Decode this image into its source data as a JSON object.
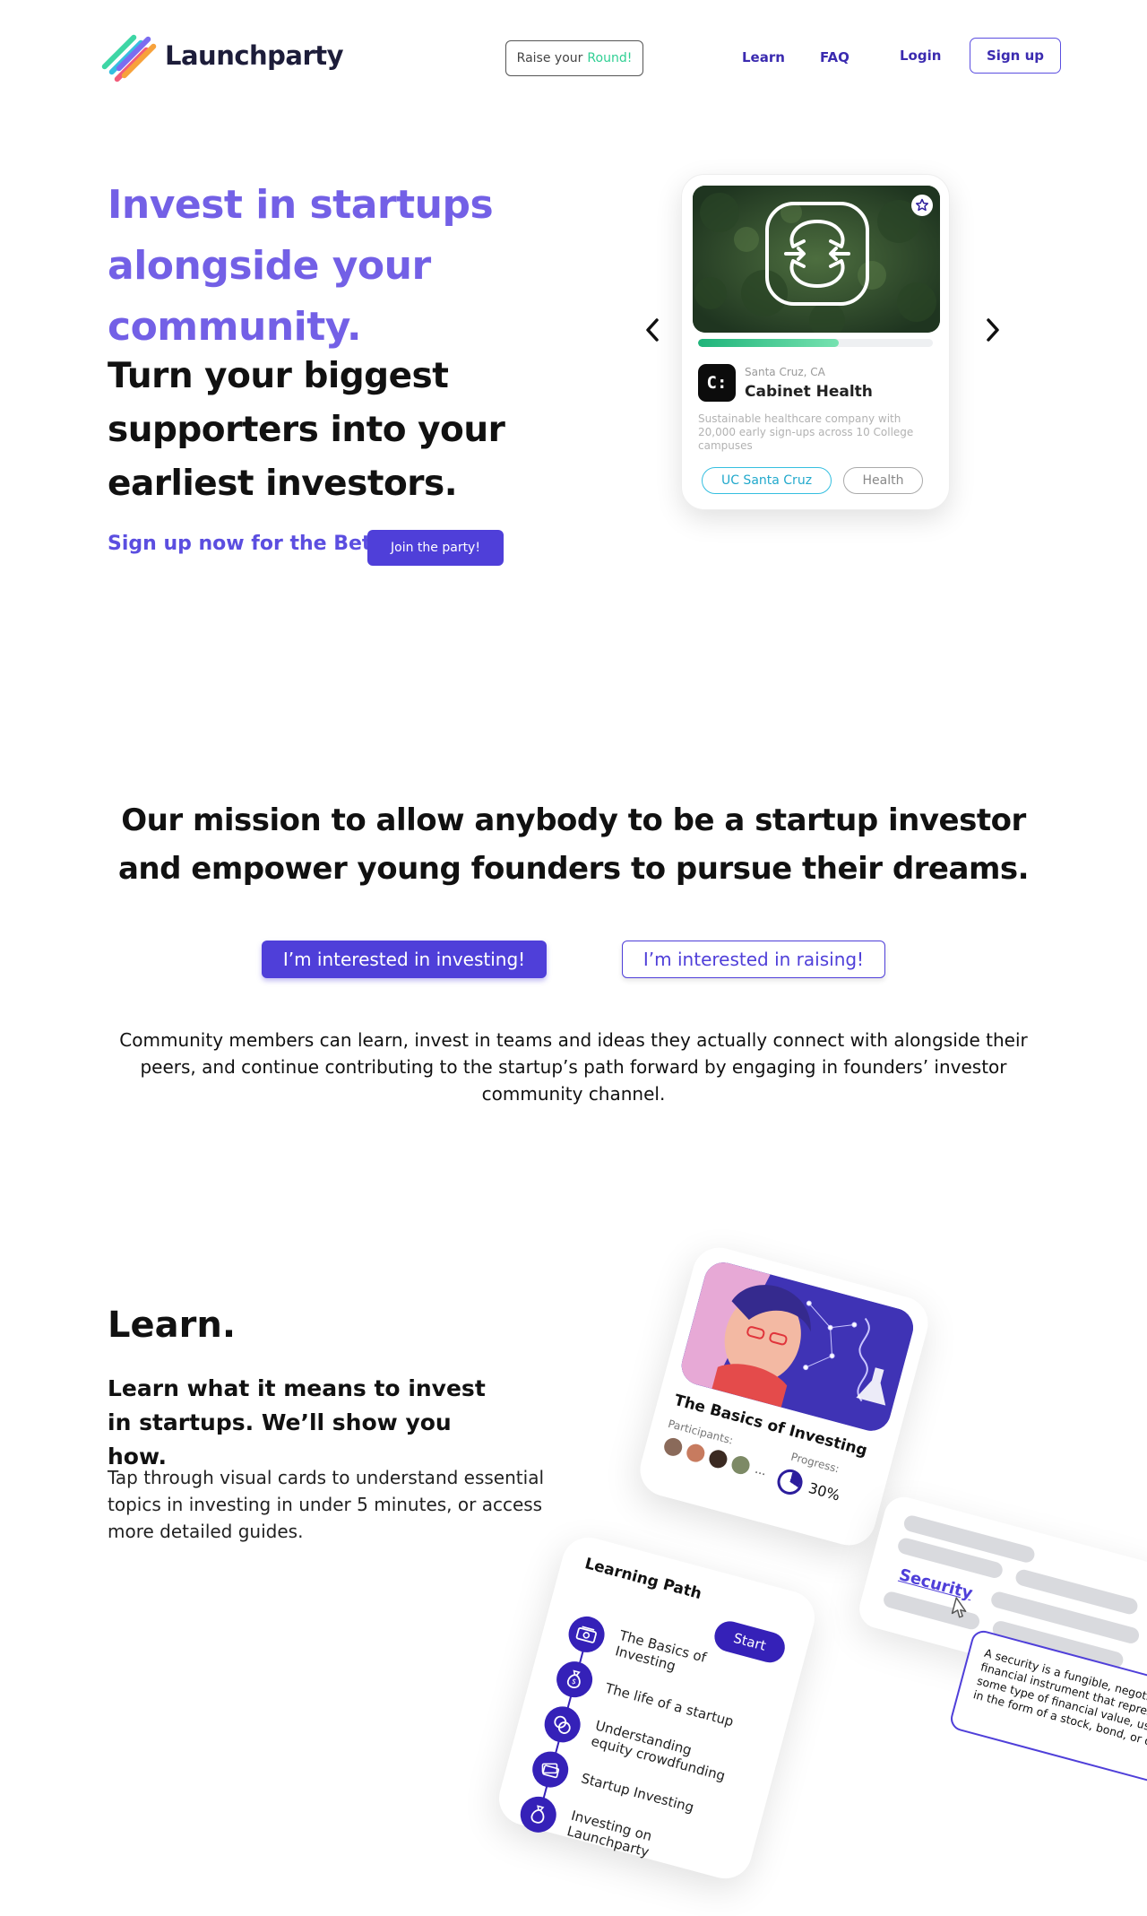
{
  "header": {
    "brand": "Launchparty",
    "raise_prefix": "Raise your",
    "raise_accent": "Round!",
    "nav": {
      "learn": "Learn",
      "faq": "FAQ",
      "login": "Login",
      "signup": "Sign up"
    },
    "logo_colors": [
      "#3ed6a5",
      "#35bfe0",
      "#7c6cf0",
      "#f25c7a",
      "#f7a23b"
    ]
  },
  "hero": {
    "title": "Invest in startups alongside your community.",
    "subtitle": "Turn your biggest supporters into your earliest investors.",
    "beta_text": "Sign up now for the Beta",
    "join_button": "Join the party!"
  },
  "company_card": {
    "location": "Santa Cruz, CA",
    "name": "Cabinet Health",
    "logo_text": "C:",
    "description": "Sustainable healthcare company with 20,000 early sign-ups across 10 College campuses",
    "funding_progress": 0.6,
    "tags": [
      "UC Santa Cruz",
      "Health"
    ],
    "icons": {
      "prev": "chevron-left-icon",
      "next": "chevron-right-icon",
      "favorite": "star-icon"
    }
  },
  "mission": {
    "text": "Our mission to allow anybody to be a startup investor and empower young founders to pursue their dreams.",
    "invest_button": "I’m interested in investing!",
    "raise_button": "I’m interested in raising!",
    "community_text": "Community members can learn, invest in teams and ideas they actually connect with alongside their peers, and continue contributing to the startup’s path forward by engaging in founders’ investor community channel."
  },
  "learn": {
    "title": "Learn.",
    "subtitle": "Learn what it means to invest in startups. We’ll show you how.",
    "body": "Tap through visual cards to understand essential topics in investing in under 5 minutes, or access more detailed guides.",
    "basics_card": {
      "title": "The Basics of Investing",
      "participants_label": "Participants:",
      "more": "...",
      "progress_label": "Progress:",
      "progress": "30%"
    },
    "path_card": {
      "title": "Learning Path",
      "start_button": "Start",
      "items": [
        {
          "label": "The Basics of Investing",
          "icon": "money-icon"
        },
        {
          "label": "The life of a startup",
          "icon": "money-bag-icon"
        },
        {
          "label": "Understanding equity crowdfunding",
          "icon": "coins-icon"
        },
        {
          "label": "Startup Investing",
          "icon": "cash-stack-icon"
        },
        {
          "label": "Investing on Launchparty",
          "icon": "money-bag-icon"
        }
      ]
    },
    "security_card": {
      "word": "Security",
      "definition": "A security is a fungible, negotiable financial instrument that represents some type of financial value, usually in the form of a stock, bond, or option."
    }
  },
  "colors": {
    "brand_purple": "#4f3fd9",
    "headline_purple": "#7360e6",
    "deep_purple": "#3521b8",
    "mint": "#2fcf93",
    "cyan": "#35bfe0"
  }
}
